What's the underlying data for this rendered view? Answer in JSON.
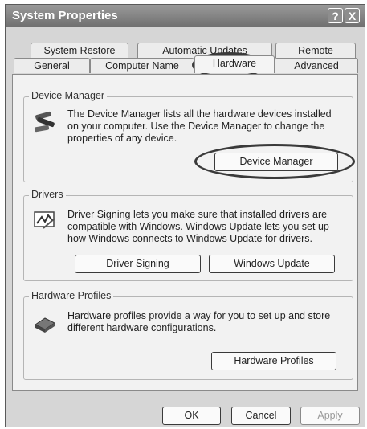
{
  "window": {
    "title": "System Properties",
    "help": "?",
    "close": "X"
  },
  "tabs_back": [
    "System Restore",
    "Automatic Updates",
    "Remote"
  ],
  "tabs_front": [
    "General",
    "Computer Name",
    "Hardware",
    "Advanced"
  ],
  "device_manager": {
    "legend": "Device Manager",
    "desc": [
      "The Device Manager lists all the hardware devices installed",
      "on your computer. Use the Device Manager to change the",
      "properties of any device."
    ],
    "button": "Device Manager"
  },
  "drivers": {
    "legend": "Drivers",
    "desc": [
      "Driver Signing lets you make sure that installed drivers are",
      "compatible with Windows. Windows Update lets you set up",
      "how Windows connects to Windows Update for drivers."
    ],
    "button_signing": "Driver Signing",
    "button_update": "Windows Update"
  },
  "hardware_profiles": {
    "legend": "Hardware Profiles",
    "desc": [
      "Hardware profiles provide a way for you to set up and store",
      "different hardware configurations."
    ],
    "button": "Hardware Profiles"
  },
  "footer": {
    "ok": "OK",
    "cancel": "Cancel",
    "apply": "Apply"
  }
}
